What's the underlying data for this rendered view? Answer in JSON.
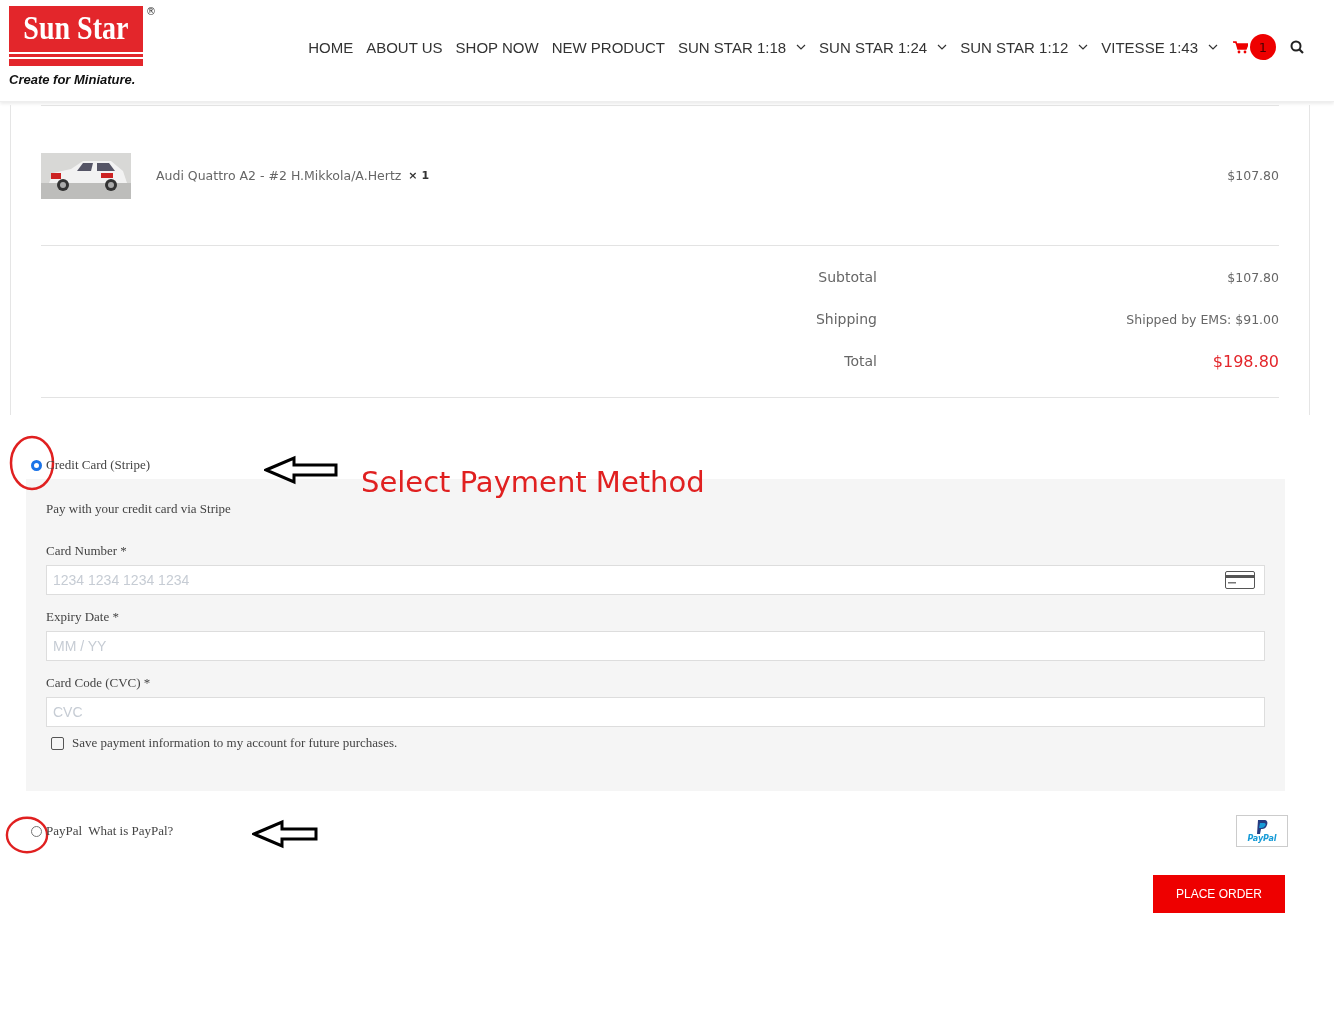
{
  "logo": {
    "brand": "Sun Star",
    "registered": "®",
    "tagline": "Create for Miniature."
  },
  "nav": [
    {
      "label": "HOME",
      "dropdown": false
    },
    {
      "label": "ABOUT US",
      "dropdown": false
    },
    {
      "label": "SHOP NOW",
      "dropdown": false
    },
    {
      "label": "NEW PRODUCT",
      "dropdown": false
    },
    {
      "label": "SUN STAR 1:18",
      "dropdown": true
    },
    {
      "label": "SUN STAR 1:24",
      "dropdown": true
    },
    {
      "label": "SUN STAR 1:12",
      "dropdown": true
    },
    {
      "label": "VITESSE 1:43",
      "dropdown": true
    }
  ],
  "cart_count": "1",
  "order": {
    "items": [
      {
        "kind": "picture",
        "name": "Audi Quattro A2 - #2 H.Mikkola/A.Hertz",
        "quantity": "× 1",
        "price": "$107.80"
      }
    ],
    "totals": [
      {
        "label": "Subtotal",
        "value": "$107.80",
        "kind": "normal"
      },
      {
        "label": "Shipping",
        "value": "Shipped by EMS: $91.00",
        "kind": "normal"
      },
      {
        "label": "Total",
        "value": "$198.80",
        "kind": "total"
      }
    ]
  },
  "payment_methods": [
    {
      "label": "Credit Card (Stripe)",
      "selected": true,
      "description": "Pay with your credit card via Stripe",
      "fields": [
        {
          "label": "Card Number *",
          "placeholder": "1234 1234 1234 1234",
          "card_icon": true
        },
        {
          "label": "Expiry Date *",
          "placeholder": "MM / YY",
          "card_icon": false
        },
        {
          "label": "Card Code (CVC) *",
          "placeholder": "CVC",
          "card_icon": false
        }
      ],
      "save_option": {
        "label": "Save payment information to my account for future purchases.",
        "checked": false
      }
    },
    {
      "label": "PayPal",
      "link": "What is PayPal?",
      "selected": false,
      "logo_text": "PayPal"
    }
  ],
  "place_order": "PLACE ORDER",
  "annotation": "Select Payment Method"
}
